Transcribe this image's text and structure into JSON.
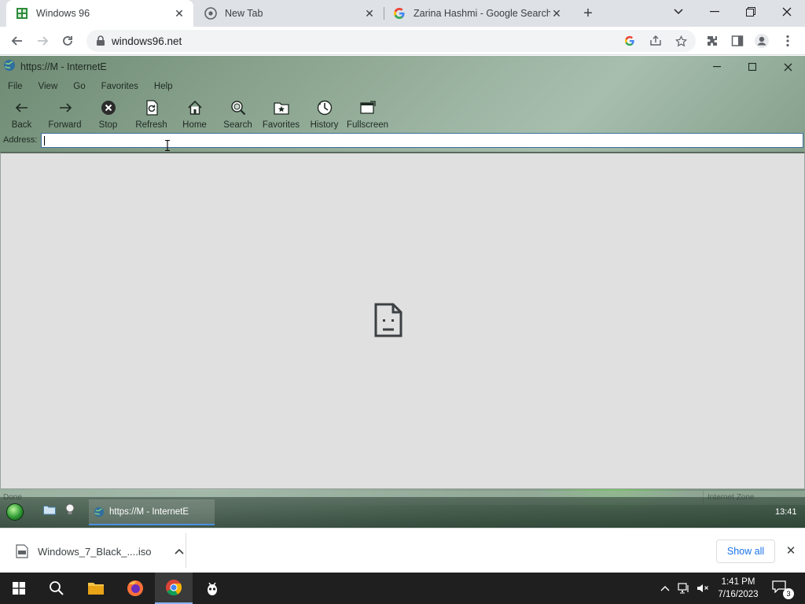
{
  "browser": {
    "tabs": [
      {
        "title": "Windows 96",
        "favicon": "windows96-icon",
        "active": true
      },
      {
        "title": "New Tab",
        "favicon": "chrome-icon",
        "active": false
      },
      {
        "title": "Zarina Hashmi - Google Search",
        "favicon": "google-icon",
        "active": false
      }
    ],
    "url": "windows96.net"
  },
  "w96": {
    "window_title": "https://M - InternetE",
    "menu": [
      "File",
      "View",
      "Go",
      "Favorites",
      "Help"
    ],
    "toolbar": [
      "Back",
      "Forward",
      "Stop",
      "Refresh",
      "Home",
      "Search",
      "Favorites",
      "History",
      "Fullscreen"
    ],
    "address_label": "Address:",
    "address_value": "",
    "status_left": "Done",
    "status_right": "Internet Zone",
    "taskbar_button": "https://M - InternetE",
    "clock": "13:41"
  },
  "downloads": {
    "file_name": "Windows_7_Black_....iso",
    "show_all": "Show all"
  },
  "os": {
    "time": "1:41 PM",
    "date": "7/16/2023",
    "notification_count": "3"
  }
}
